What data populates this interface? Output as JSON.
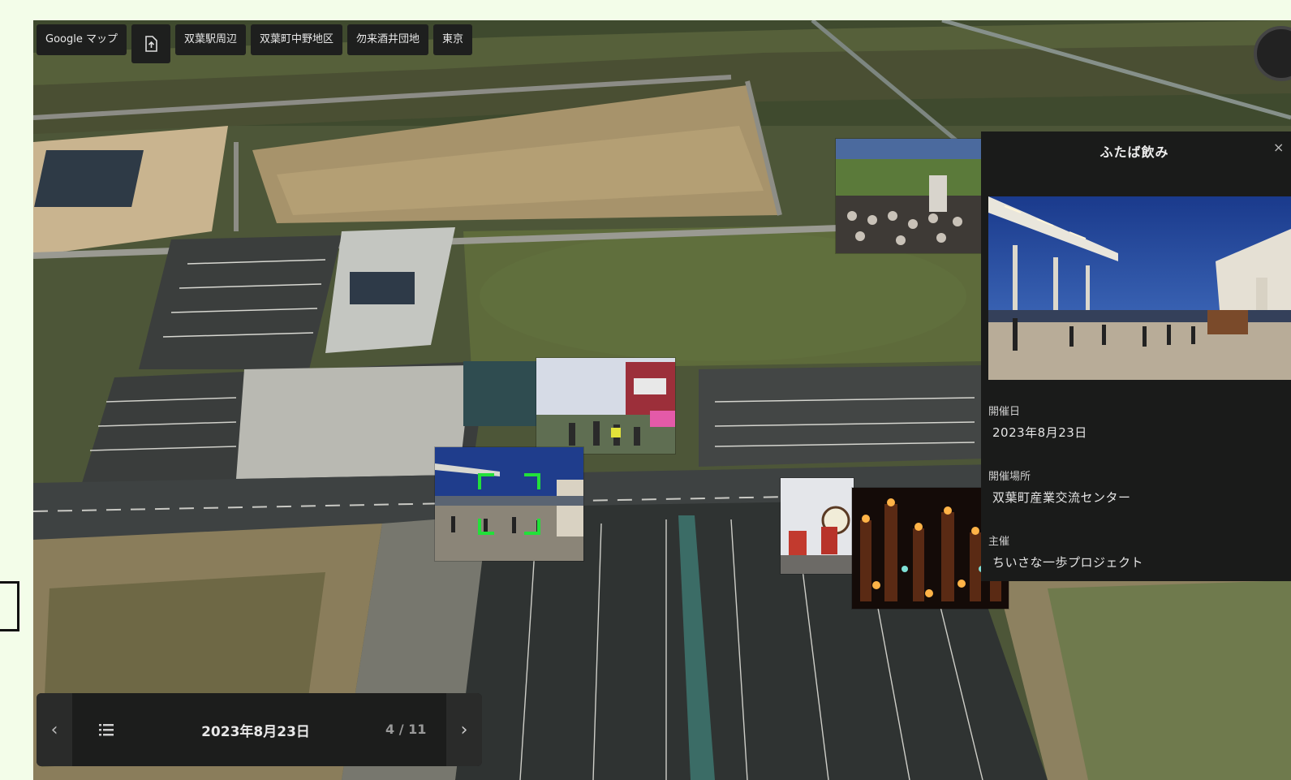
{
  "toolbar": {
    "google_maps": "Google マップ",
    "export_icon": "file-export-icon",
    "places": [
      "双葉駅周辺",
      "双葉町中野地区",
      "勿来酒井団地",
      "東京"
    ]
  },
  "panel": {
    "title": "ふたば飲み",
    "close": "×",
    "fields": [
      {
        "label": "開催日",
        "value": "2023年8月23日"
      },
      {
        "label": "開催場所",
        "value": "双葉町産業交流センター"
      },
      {
        "label": "主催",
        "value": "ちいさな一歩プロジェクト"
      }
    ]
  },
  "nav": {
    "prev": "‹",
    "next": "›",
    "date": "2023年8月23日",
    "count": "4 / 11"
  },
  "colors": {
    "page_bg": "#f3fde9",
    "panel_bg": "#1a1b1a",
    "focus_bracket": "#22e03a"
  }
}
